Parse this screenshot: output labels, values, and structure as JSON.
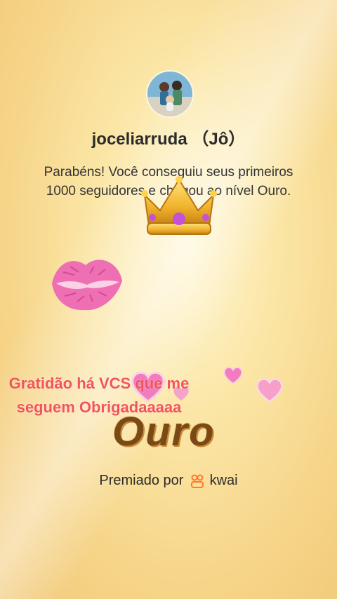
{
  "profile": {
    "username": "joceliarruda （Jô）",
    "message": "Parabéns! Você conseguiu seus primeiros 1000 seguidores e chegou ao nível Ouro."
  },
  "overlay": {
    "gratitude_text": "Gratidão há VCS que me seguem Obrigadaaaaa",
    "level_text": "Ouro"
  },
  "footer": {
    "premiado_label": "Premiado por",
    "brand": "kwai"
  },
  "colors": {
    "accent_red": "#f2545b",
    "ouro_brown": "#7a4a16",
    "kwai_orange": "#ff7a2f"
  }
}
